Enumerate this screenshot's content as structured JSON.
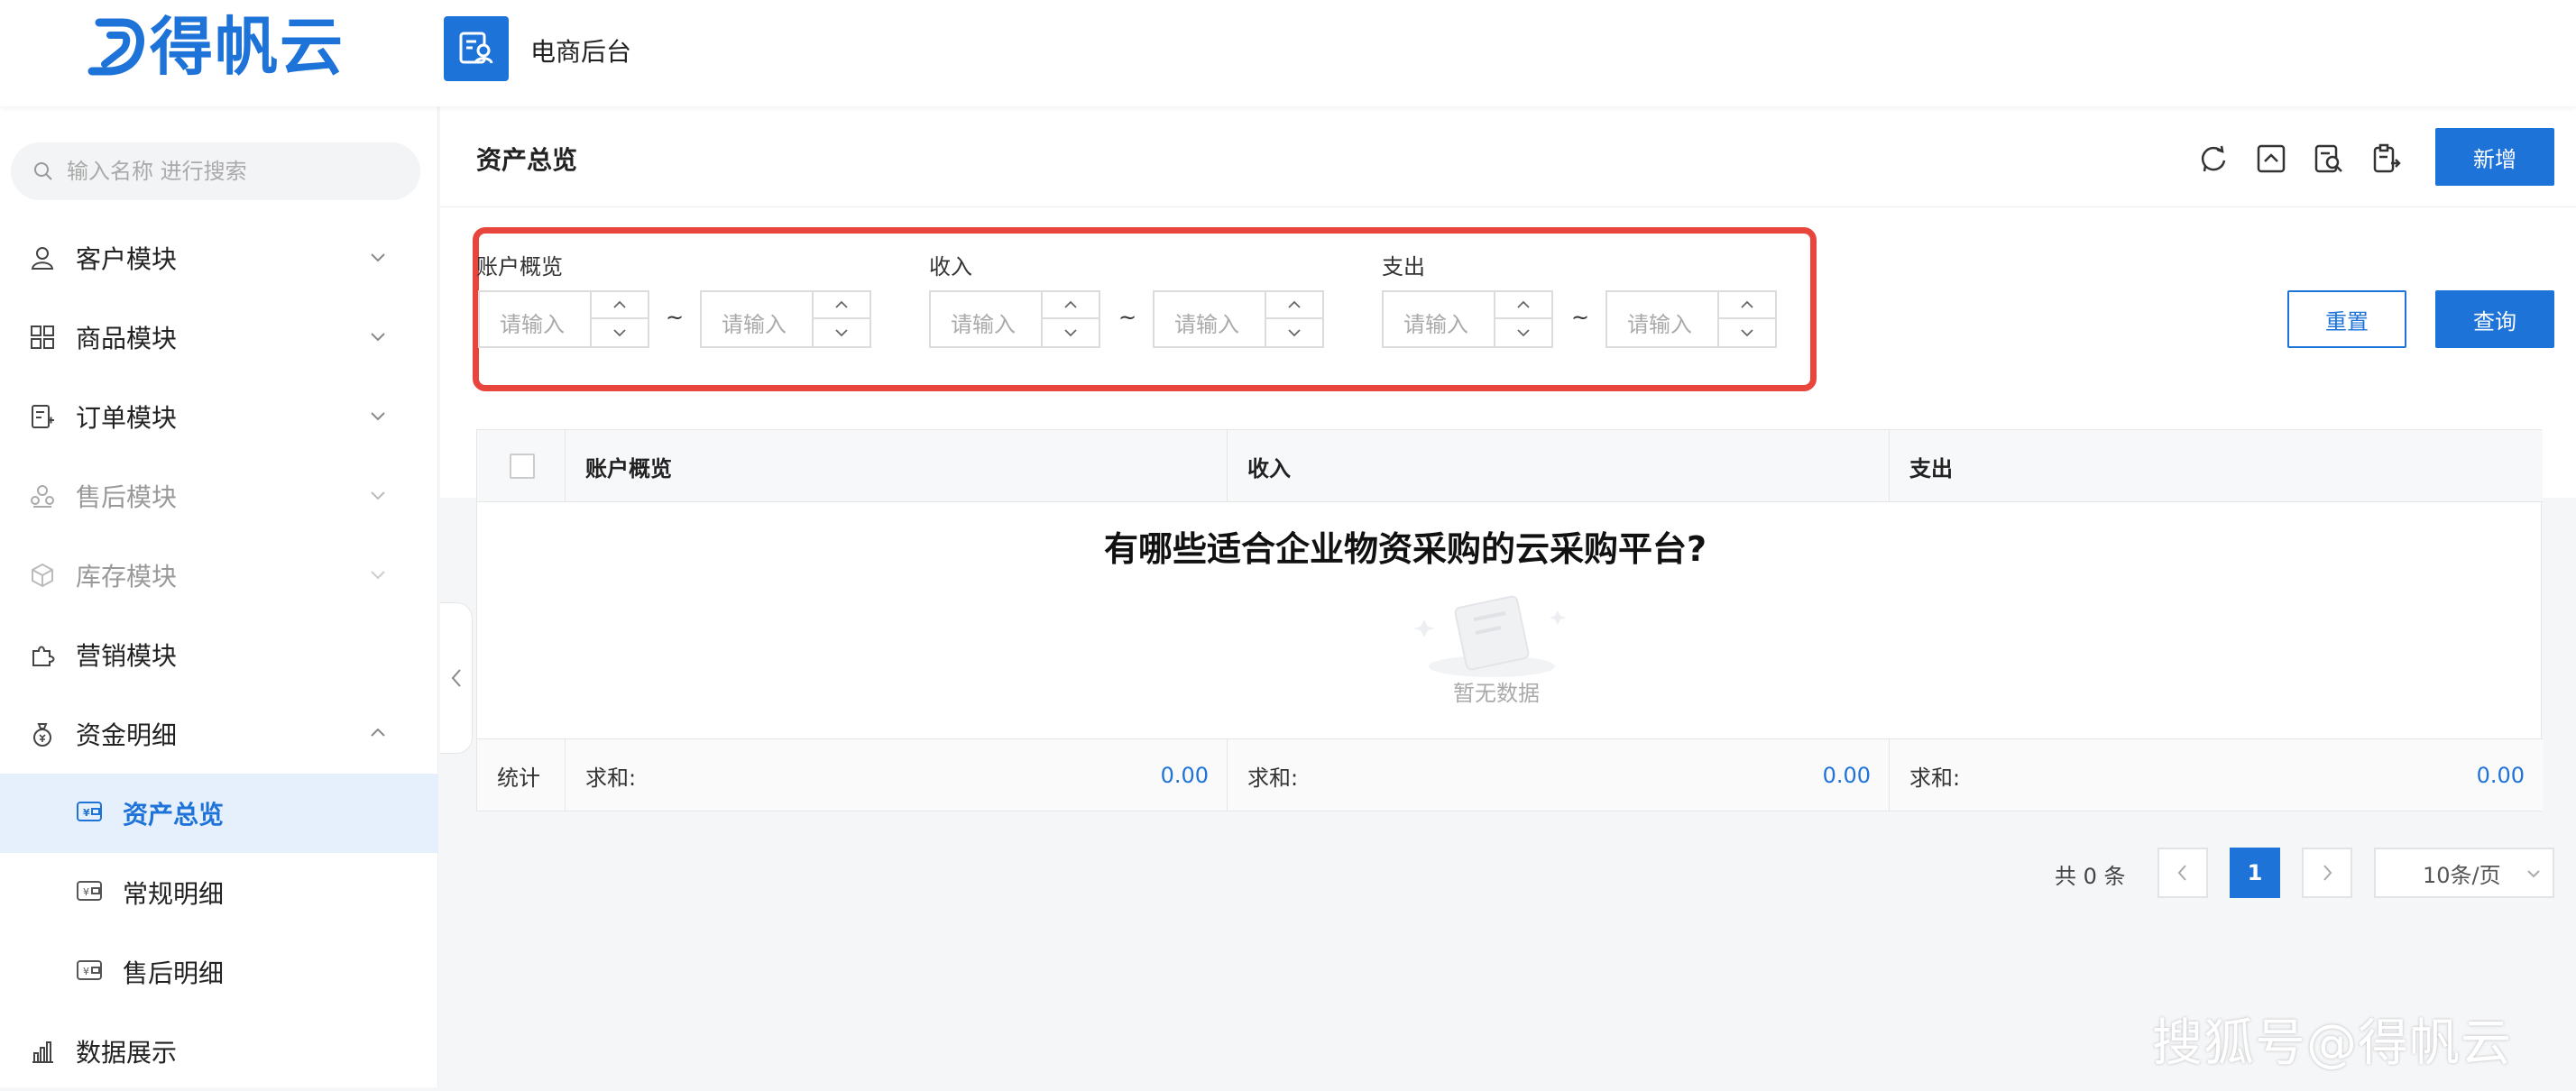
{
  "brand": {
    "logo_text": "得帆云",
    "app_title": "电商后台",
    "accent": "#1e73d8"
  },
  "search": {
    "placeholder": "输入名称 进行搜索"
  },
  "sidebar": {
    "items": [
      {
        "label": "客户模块",
        "icon": "user-icon",
        "expandable": true
      },
      {
        "label": "商品模块",
        "icon": "grid-icon",
        "expandable": true
      },
      {
        "label": "订单模块",
        "icon": "order-icon",
        "expandable": true
      },
      {
        "label": "售后模块",
        "icon": "aftersale-icon",
        "expandable": true
      },
      {
        "label": "库存模块",
        "icon": "cube-icon",
        "expandable": true
      },
      {
        "label": "营销模块",
        "icon": "puzzle-icon",
        "expandable": false
      },
      {
        "label": "资金明细",
        "icon": "money-bag-icon",
        "expandable": true,
        "expanded": true
      }
    ],
    "sub_items": [
      {
        "label": "资产总览",
        "icon": "wallet-icon",
        "active": true
      },
      {
        "label": "常规明细",
        "icon": "wallet-icon",
        "active": false
      },
      {
        "label": "售后明细",
        "icon": "wallet-icon",
        "active": false
      }
    ],
    "last_item": {
      "label": "数据展示",
      "icon": "bar-chart-icon"
    }
  },
  "page": {
    "title": "资产总览",
    "add_label": "新增",
    "reset_label": "重置",
    "query_label": "查询"
  },
  "filters": [
    {
      "label": "账户概览",
      "from_placeholder": "请输入",
      "to_placeholder": "请输入"
    },
    {
      "label": "收入",
      "from_placeholder": "请输入",
      "to_placeholder": "请输入"
    },
    {
      "label": "支出",
      "from_placeholder": "请输入",
      "to_placeholder": "请输入"
    }
  ],
  "range_separator": "~",
  "table": {
    "columns": [
      "账户概览",
      "收入",
      "支出"
    ],
    "empty_text": "暂无数据",
    "footer": {
      "label": "统计",
      "sum_label": "求和:",
      "values": [
        "0.00",
        "0.00",
        "0.00"
      ]
    }
  },
  "overlay_title": "有哪些适合企业物资采购的云采购平台?",
  "pagination": {
    "total_text": "共 0 条",
    "current_page": "1",
    "page_size": "10条/页"
  },
  "watermark": "搜狐号@得帆云"
}
